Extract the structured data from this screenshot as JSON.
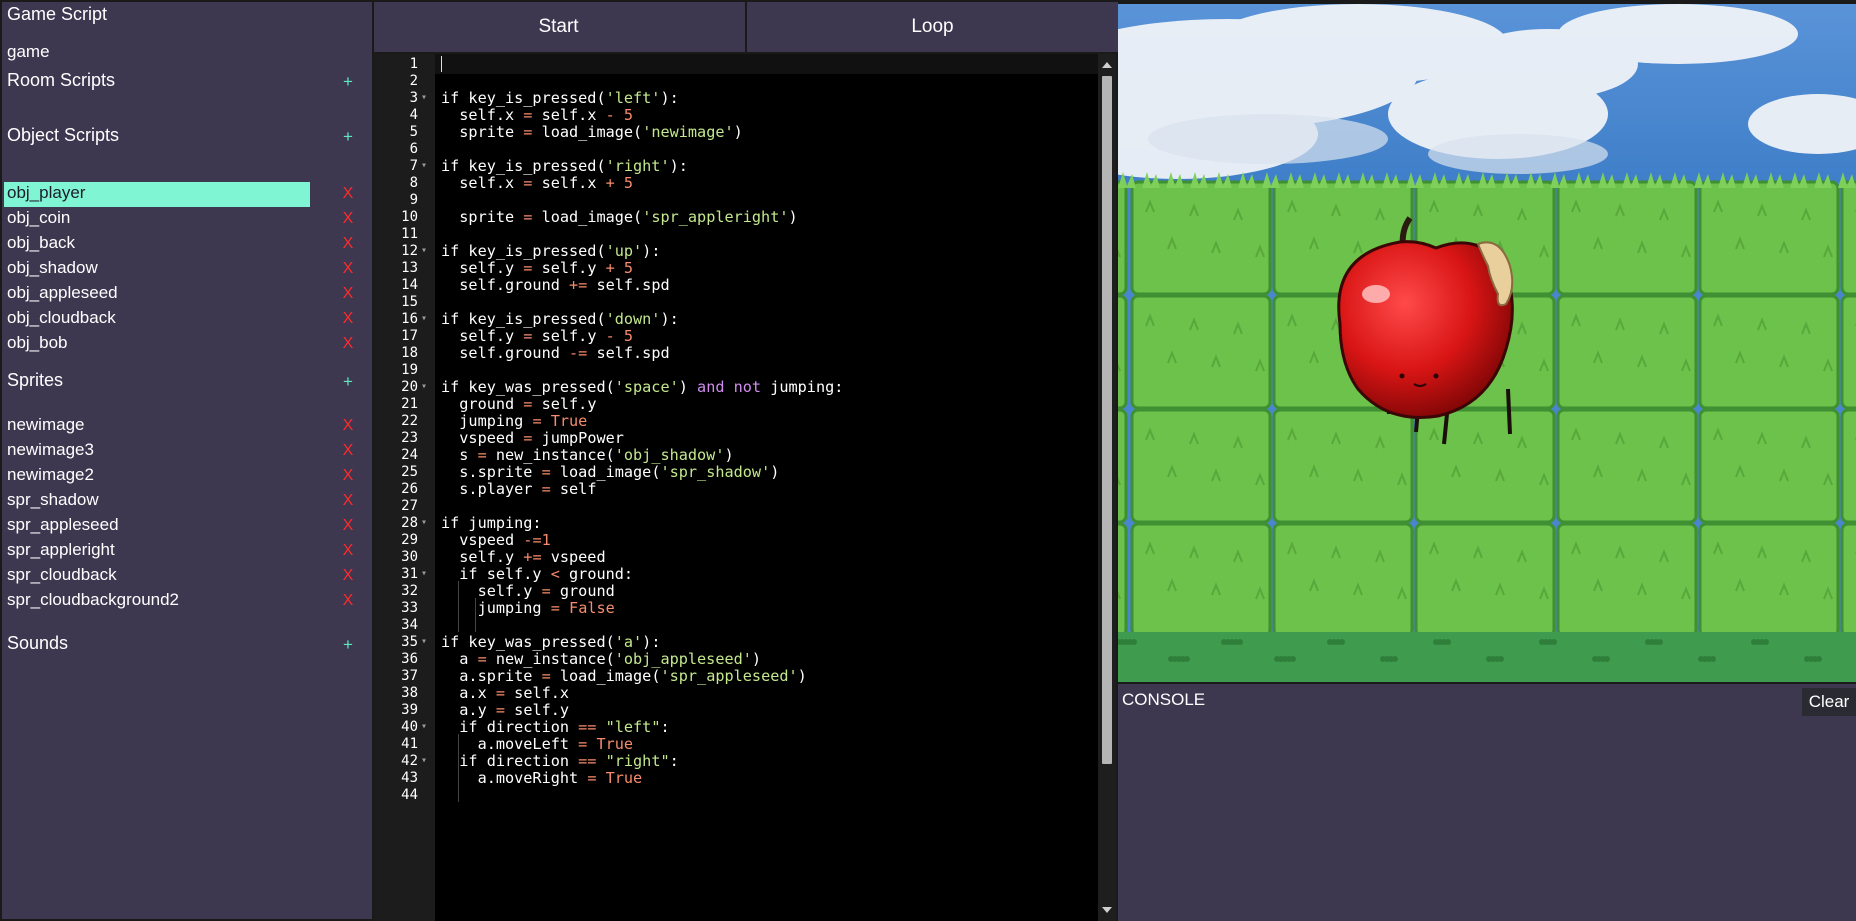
{
  "sidebar": {
    "game_script_title": "Game Script",
    "game_item": "game",
    "room_scripts": {
      "label": "Room Scripts",
      "add": "+"
    },
    "object_scripts": {
      "label": "Object Scripts",
      "add": "+",
      "items": [
        "obj_player",
        "obj_coin",
        "obj_back",
        "obj_shadow",
        "obj_appleseed",
        "obj_cloudback",
        "obj_bob"
      ],
      "selected": "obj_player"
    },
    "sprites": {
      "label": "Sprites",
      "add": "+",
      "items": [
        "newimage",
        "newimage3",
        "newimage2",
        "spr_shadow",
        "spr_appleseed",
        "spr_appleright",
        "spr_cloudback",
        "spr_cloudbackground2"
      ]
    },
    "sounds": {
      "label": "Sounds",
      "add": "+"
    },
    "delete_glyph": "X"
  },
  "editor": {
    "tabs": [
      {
        "label": "Start"
      },
      {
        "label": "Loop"
      }
    ],
    "lines": [
      "",
      "",
      "if key_is_pressed('left'):",
      "  self.x = self.x - 5",
      "  sprite = load_image('newimage')",
      "",
      "if key_is_pressed('right'):",
      "  self.x = self.x + 5",
      "",
      "  sprite = load_image('spr_appleright')",
      "",
      "if key_is_pressed('up'):",
      "  self.y = self.y + 5",
      "  self.ground += self.spd",
      "",
      "if key_is_pressed('down'):",
      "  self.y = self.y - 5",
      "  self.ground -= self.spd",
      "",
      "if key_was_pressed('space') and not jumping:",
      "  ground = self.y",
      "  jumping = True",
      "  vspeed = jumpPower",
      "  s = new_instance('obj_shadow')",
      "  s.sprite = load_image('spr_shadow')",
      "  s.player = self",
      "",
      "if jumping:",
      "  vspeed -=1",
      "  self.y += vspeed",
      "  if self.y < ground:",
      "    self.y = ground",
      "    jumping = False",
      "",
      "if key_was_pressed('a'):",
      "  a = new_instance('obj_appleseed')",
      "  a.sprite = load_image('spr_appleseed')",
      "  a.x = self.x",
      "  a.y = self.y",
      "  if direction == \"left\":",
      "    a.moveLeft = True",
      "  if direction == \"right\":",
      "    a.moveRight = True",
      ""
    ],
    "fold_lines": [
      3,
      7,
      12,
      16,
      20,
      28,
      31,
      35,
      40,
      42
    ]
  },
  "game": {
    "sprite_icon": "apple-sprite"
  },
  "console": {
    "title": "CONSOLE",
    "clear_label": "Clear"
  },
  "colors": {
    "panel": "#3d3750",
    "accent": "#7ff5d4",
    "delete": "#ff2a2a",
    "string": "#c3e88d",
    "keyword": "#d18cf0",
    "number": "#f78c6c"
  }
}
